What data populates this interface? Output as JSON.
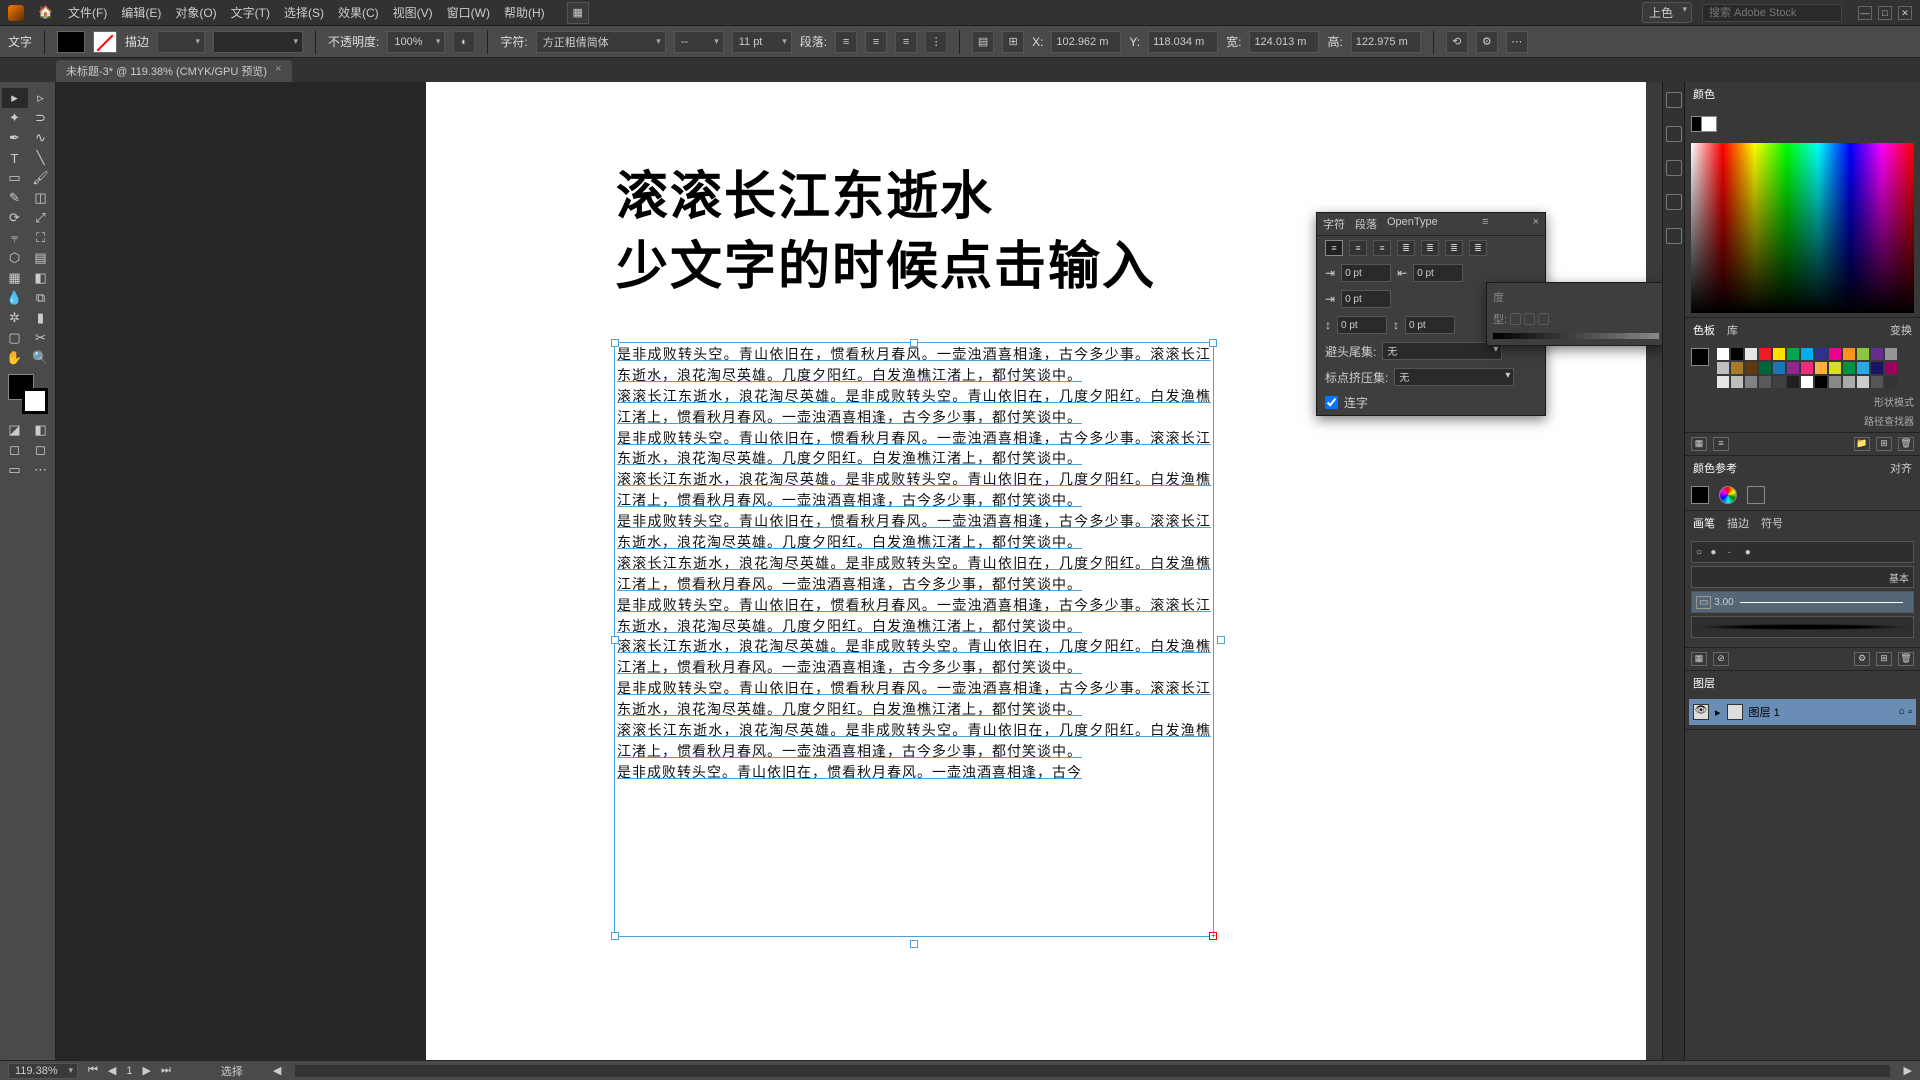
{
  "menubar": {
    "items": [
      "文件(F)",
      "编辑(E)",
      "对象(O)",
      "文字(T)",
      "选择(S)",
      "效果(C)",
      "视图(V)",
      "窗口(W)",
      "帮助(H)"
    ],
    "workspace": "上色",
    "search_placeholder": "搜索 Adobe Stock"
  },
  "ctrlbar": {
    "tool": "文字",
    "stroke": "描边",
    "opacity_label": "不透明度:",
    "opacity": "100%",
    "char_label": "字符:",
    "font": "方正粗倩简体",
    "size": "11 pt",
    "para_label": "段落:",
    "x_label": "X:",
    "x": "102.962 m",
    "y_label": "Y:",
    "y": "118.034 m",
    "w_label": "宽:",
    "w": "124.013 m",
    "h_label": "高:",
    "h": "122.975 m"
  },
  "doctab": {
    "name": "未标题-3* @ 119.38% (CMYK/GPU 预览)"
  },
  "headline": {
    "l1": "滚滚长江东逝水",
    "l2": "少文字的时候点击输入"
  },
  "body_blocks": [
    "是非成败转头空。青山依旧在，惯看秋月春风。一壶浊酒喜相逢，古今多少事。滚滚长江东逝水，浪花淘尽英雄。几度夕阳红。白发渔樵江渚上，都付笑谈中。",
    "滚滚长江东逝水，浪花淘尽英雄。是非成败转头空。青山依旧在，几度夕阳红。白发渔樵江渚上，惯看秋月春风。一壶浊酒喜相逢，古今多少事，都付笑谈中。",
    "是非成败转头空。青山依旧在，惯看秋月春风。一壶浊酒喜相逢，古今多少事。滚滚长江东逝水，浪花淘尽英雄。几度夕阳红。白发渔樵江渚上，都付笑谈中。",
    "滚滚长江东逝水，浪花淘尽英雄。是非成败转头空。青山依旧在，几度夕阳红。白发渔樵江渚上，惯看秋月春风。一壶浊酒喜相逢，古今多少事，都付笑谈中。",
    "是非成败转头空。青山依旧在，惯看秋月春风。一壶浊酒喜相逢，古今多少事。滚滚长江东逝水，浪花淘尽英雄。几度夕阳红。白发渔樵江渚上，都付笑谈中。",
    "滚滚长江东逝水，浪花淘尽英雄。是非成败转头空。青山依旧在，几度夕阳红。白发渔樵江渚上，惯看秋月春风。一壶浊酒喜相逢，古今多少事，都付笑谈中。",
    "是非成败转头空。青山依旧在，惯看秋月春风。一壶浊酒喜相逢，古今多少事。滚滚长江东逝水，浪花淘尽英雄。几度夕阳红。白发渔樵江渚上，都付笑谈中。",
    "滚滚长江东逝水，浪花淘尽英雄。是非成败转头空。青山依旧在，几度夕阳红。白发渔樵江渚上，惯看秋月春风。一壶浊酒喜相逢，古今多少事，都付笑谈中。",
    "是非成败转头空。青山依旧在，惯看秋月春风。一壶浊酒喜相逢，古今多少事。滚滚长江东逝水，浪花淘尽英雄。几度夕阳红。白发渔樵江渚上，都付笑谈中。",
    "滚滚长江东逝水，浪花淘尽英雄。是非成败转头空。青山依旧在，几度夕阳红。白发渔樵江渚上，惯看秋月春风。一壶浊酒喜相逢，古今多少事，都付笑谈中。",
    "是非成败转头空。青山依旧在，惯看秋月春风。一壶浊酒喜相逢，古今"
  ],
  "paragraph_panel": {
    "tabs": [
      "字符",
      "段落",
      "OpenType"
    ],
    "indent": "0 pt",
    "hyphen_label": "避头尾集:",
    "hyphen": "无",
    "punct_label": "标点挤压集:",
    "punct": "无",
    "hang": "连字"
  },
  "color_panel": {
    "title": "颜色"
  },
  "swatch_panel": {
    "tabs": [
      "色板",
      "库"
    ]
  },
  "guide_panel": {
    "title": "颜色参考"
  },
  "brush_panel": {
    "tabs": [
      "画笔",
      "描边",
      "符号"
    ],
    "width": "3.00",
    "basic": "基本"
  },
  "layer_panel": {
    "title": "图层",
    "layer": "图层 1"
  },
  "transform_labels": {
    "transform": "变换",
    "mode": "形状模式",
    "pathfind": "路径查找器",
    "align": "对齐"
  },
  "statusbar": {
    "zoom": "119.38%",
    "page": "1",
    "sel": "选择"
  },
  "swatch_colors": [
    "#fff",
    "#000",
    "#e6e6e6",
    "#ed1c24",
    "#ffde00",
    "#00a651",
    "#00aeef",
    "#2e3192",
    "#ec008c",
    "#f7941e",
    "#8dc63e",
    "#662d91",
    "#939598",
    "#c0c0c0",
    "#a6792b",
    "#603913",
    "#006838",
    "#1c75bc",
    "#92278f",
    "#ee2a7b",
    "#fbb040",
    "#d7df23",
    "#009444",
    "#27aae1",
    "#1b1464",
    "#9e005d",
    "#e6e7e8",
    "#bcbec0",
    "#808285",
    "#58595b",
    "#414042",
    "#231f20",
    "#fff",
    "#000",
    "#888",
    "#aaa",
    "#ccc",
    "#555",
    "#333"
  ]
}
